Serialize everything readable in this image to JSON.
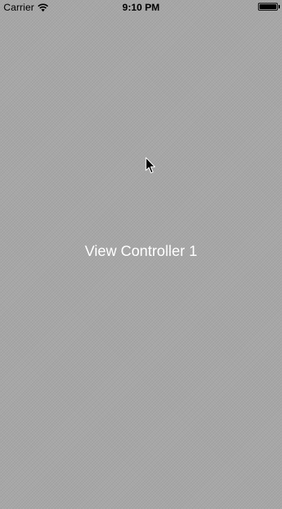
{
  "status_bar": {
    "carrier": "Carrier",
    "time": "9:10 PM",
    "wifi_icon": "wifi-icon",
    "battery_icon": "battery-icon",
    "battery_level": 1.0
  },
  "main": {
    "title": "View Controller 1"
  },
  "colors": {
    "background": "#a7a7a7",
    "title_text": "#ffffff",
    "status_text": "#000000"
  }
}
